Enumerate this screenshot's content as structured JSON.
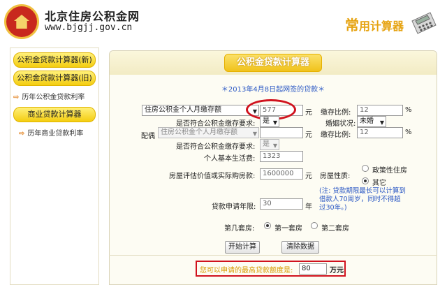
{
  "site": {
    "title": "北京住房公积金网",
    "url": "www.bjgjj.gov.cn",
    "calc_tag_big": "常",
    "calc_tag": "用计算器"
  },
  "sidebar": {
    "items": [
      {
        "label": "公积金贷款计算器(新)"
      },
      {
        "label": "公积金贷款计算器(旧)"
      },
      {
        "label": "历年公积金贷款利率"
      },
      {
        "label": "商业贷款计算器"
      },
      {
        "label": "历年商业贷款利率"
      }
    ]
  },
  "main": {
    "title": "公积金贷款计算器",
    "note": "＊2013年4月8日起网签的贷款＊"
  },
  "form": {
    "deposit_select": "住房公积金个人月缴存额",
    "deposit_value": "577",
    "yuan": "元",
    "ratio_label": "缴存比例:",
    "ratio_value": "12",
    "percent": "%",
    "eligible_label": "是否符合公积金缴存要求:",
    "eligible_value": "是",
    "marriage_label": "婚姻状况:",
    "marriage_value": "未婚",
    "spouse_label": "配偶",
    "spouse_select": "住房公积金个人月缴存额",
    "spouse_value": "",
    "spouse_ratio_label": "缴存比例:",
    "spouse_ratio_value": "12",
    "spouse_eligible_label": "是否符合公积金缴存要求:",
    "spouse_eligible_value": "是",
    "living_label": "个人基本生活费:",
    "living_value": "1323",
    "price_label": "房屋评估价值或实际购房款:",
    "price_value": "1600000",
    "house_type_label": "房屋性质:",
    "house_type_opt1": "政策性住房",
    "house_type_opt2": "其它",
    "term_label": "贷款申请年限:",
    "term_value": "30",
    "year": "年",
    "hint": "(注: 贷款期限最长可以计算到借款人70周岁，同时不得超过30年。)",
    "which_label": "第几套房:",
    "which_opt1": "第一套房",
    "which_opt2": "第二套房",
    "calc_btn": "开始计算",
    "clear_btn": "清除数据",
    "result_label": "您可以申请的最高贷款额度是:",
    "result_value": "80",
    "result_unit": "万元"
  }
}
